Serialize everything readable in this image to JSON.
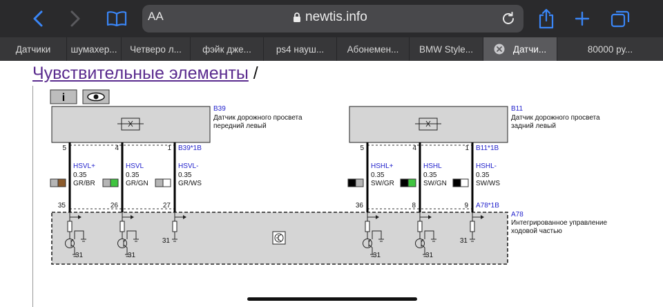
{
  "browser": {
    "text_size_label": "AA",
    "url": "newtis.info",
    "tabs": [
      {
        "label": "Датчики",
        "active": false
      },
      {
        "label": "шумахер...",
        "active": false
      },
      {
        "label": "Четверо л...",
        "active": false
      },
      {
        "label": "фэйк дже...",
        "active": false
      },
      {
        "label": "ps4 науш...",
        "active": false
      },
      {
        "label": "Абонемен...",
        "active": false
      },
      {
        "label": "BMW Style...",
        "active": false
      },
      {
        "label": "Датчи...",
        "active": true
      },
      {
        "label": "80000 ру...",
        "active": false
      }
    ]
  },
  "page": {
    "title_link": "Чувствительные элементы",
    "title_separator": " /"
  },
  "diagram": {
    "sensor_front": {
      "code": "B39",
      "line1": "Датчик дорожного просвета",
      "line2": "передний левый",
      "connector": "B39*1B"
    },
    "sensor_rear": {
      "code": "B11",
      "line1": "Датчик дорожного просвета",
      "line2": "задний левый",
      "connector": "B11*1B"
    },
    "module": {
      "code": "A78",
      "line1": "Интегрированное управление",
      "line2": "ходовой частью",
      "connector": "A78*1B"
    },
    "ground_label": "31",
    "wires": [
      {
        "name": "HSVL+",
        "section": "0.35",
        "color": "GR/BR",
        "top_pin": "5",
        "bottom_pin": "35",
        "sw1": "#b5b5b5",
        "sw2": "#8b5a2b"
      },
      {
        "name": "HSVL",
        "section": "0.35",
        "color": "GR/GN",
        "top_pin": "4",
        "bottom_pin": "26",
        "sw1": "#b5b5b5",
        "sw2": "#3fc43f"
      },
      {
        "name": "HSVL-",
        "section": "0.35",
        "color": "GR/WS",
        "top_pin": "1",
        "bottom_pin": "27",
        "sw1": "#b5b5b5",
        "sw2": "#ffffff"
      },
      {
        "name": "HSHL+",
        "section": "0.35",
        "color": "SW/GR",
        "top_pin": "5",
        "bottom_pin": "36",
        "sw1": "#000000",
        "sw2": "#b5b5b5"
      },
      {
        "name": "HSHL",
        "section": "0.35",
        "color": "SW/GN",
        "top_pin": "4",
        "bottom_pin": "8",
        "sw1": "#000000",
        "sw2": "#3fc43f"
      },
      {
        "name": "HSHL-",
        "section": "0.35",
        "color": "SW/WS",
        "top_pin": "1",
        "bottom_pin": "9",
        "sw1": "#000000",
        "sw2": "#ffffff"
      }
    ]
  }
}
